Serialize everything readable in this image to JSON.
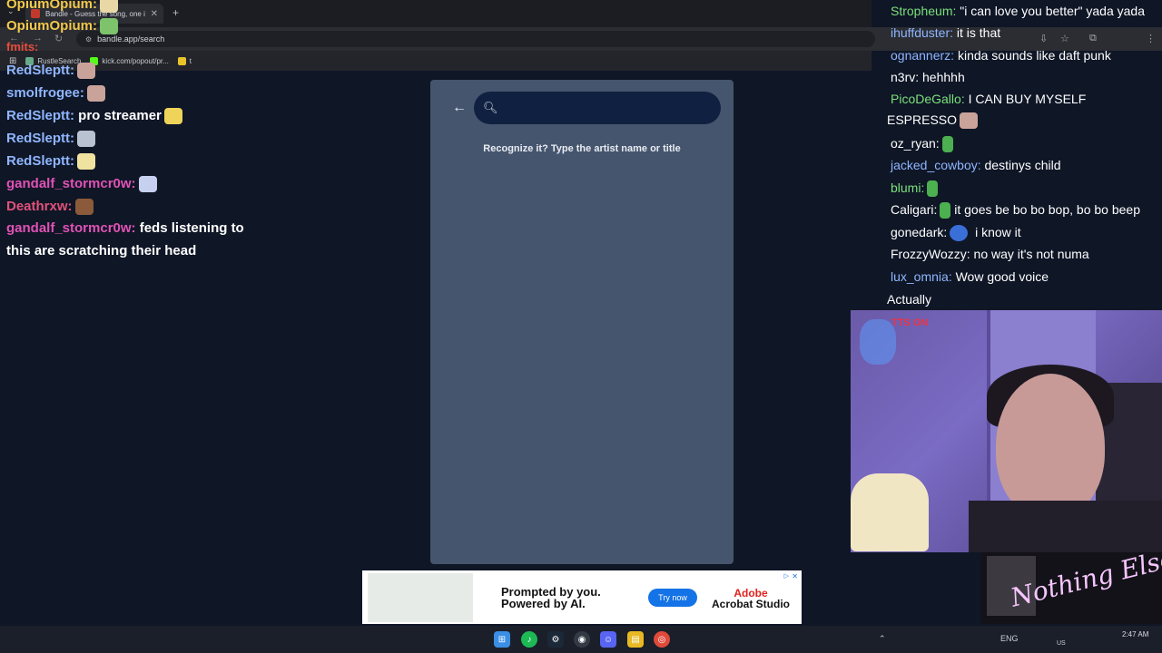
{
  "browser": {
    "tab_title": "Bandle - Guess the song, one in",
    "url": "bandle.app/search",
    "bookmarks": [
      {
        "label": "RustleSearch"
      },
      {
        "label": "kick.com/popout/pr..."
      },
      {
        "label": "t"
      }
    ]
  },
  "chat_left": [
    {
      "user": "OpiumOpium:",
      "text": "",
      "color": "#f2c94c"
    },
    {
      "user": "OpiumOpium:",
      "text": "",
      "color": "#f2c94c"
    },
    {
      "user": "fmits:",
      "text": "",
      "color": "#e74c3c"
    },
    {
      "user": "RedSleptt:",
      "text": "",
      "color": "#8fb6ff"
    },
    {
      "user": "smolfrogee:",
      "text": "",
      "color": "#8fb6ff"
    },
    {
      "user": "RedSleptt:",
      "text": "pro streamer",
      "color": "#8fb6ff"
    },
    {
      "user": "RedSleptt:",
      "text": "",
      "color": "#8fb6ff"
    },
    {
      "user": "RedSleptt:",
      "text": "",
      "color": "#8fb6ff"
    },
    {
      "user": "gandalf_stormcr0w:",
      "text": "",
      "color": "#e052b5"
    },
    {
      "user": "Deathrxw:",
      "text": "",
      "color": "#e0527a"
    },
    {
      "user": "gandalf_stormcr0w:",
      "text": "feds listening to",
      "color": "#e052b5"
    },
    {
      "user": "",
      "text": "this are scratching their head",
      "color": "#ffffff"
    }
  ],
  "chat_right": [
    {
      "user": "Stropheum:",
      "text": "\"i can love you better\" yada yada",
      "color": "#7be07b"
    },
    {
      "user": "ihuffduster:",
      "text": "it is that",
      "color": "#8fb6ff"
    },
    {
      "user": "ognannerz:",
      "text": "kinda sounds like daft punk",
      "color": "#8fb6ff"
    },
    {
      "user": "n3rv:",
      "text": "hehhhh",
      "color": "#ffffff"
    },
    {
      "user": "PicoDeGallo:",
      "text": "I CAN BUY MYSELF",
      "color": "#7be07b"
    },
    {
      "user": "",
      "text": "ESPRESSO",
      "color": "#ffffff"
    },
    {
      "user": "oz_ryan:",
      "text": "",
      "color": "#ffffff"
    },
    {
      "user": "jacked_cowboy:",
      "text": "destinys child",
      "color": "#8fb6ff"
    },
    {
      "user": "blumi:",
      "text": "",
      "color": "#7be07b"
    },
    {
      "user": "Caligari:",
      "text": "it goes be bo bo bop, bo bo beep",
      "color": "#ffffff"
    },
    {
      "user": "gonedark:",
      "text": "i know it",
      "color": "#ffffff"
    },
    {
      "user": "FrozzyWozzy:",
      "text": "no way it's not numa",
      "color": "#ffffff"
    },
    {
      "user": "lux_omnia:",
      "text": "Wow good voice",
      "color": "#8fb6ff"
    },
    {
      "user": "",
      "text": "Actually",
      "color": "#ffffff"
    }
  ],
  "app": {
    "search_placeholder": "",
    "hint": "Recognize it? Type the artist name or title"
  },
  "webcam": {
    "tts_badge": "TTS ON"
  },
  "album": {
    "title": "Nothing Else?"
  },
  "ad": {
    "headline_1": "Prompted by you.",
    "headline_2": "Powered by AI.",
    "cta": "Try now",
    "brand_1": "Adobe",
    "brand_2": "Acrobat Studio"
  },
  "taskbar": {
    "lang": "ENG",
    "region": "US",
    "time": "2:47 AM"
  }
}
